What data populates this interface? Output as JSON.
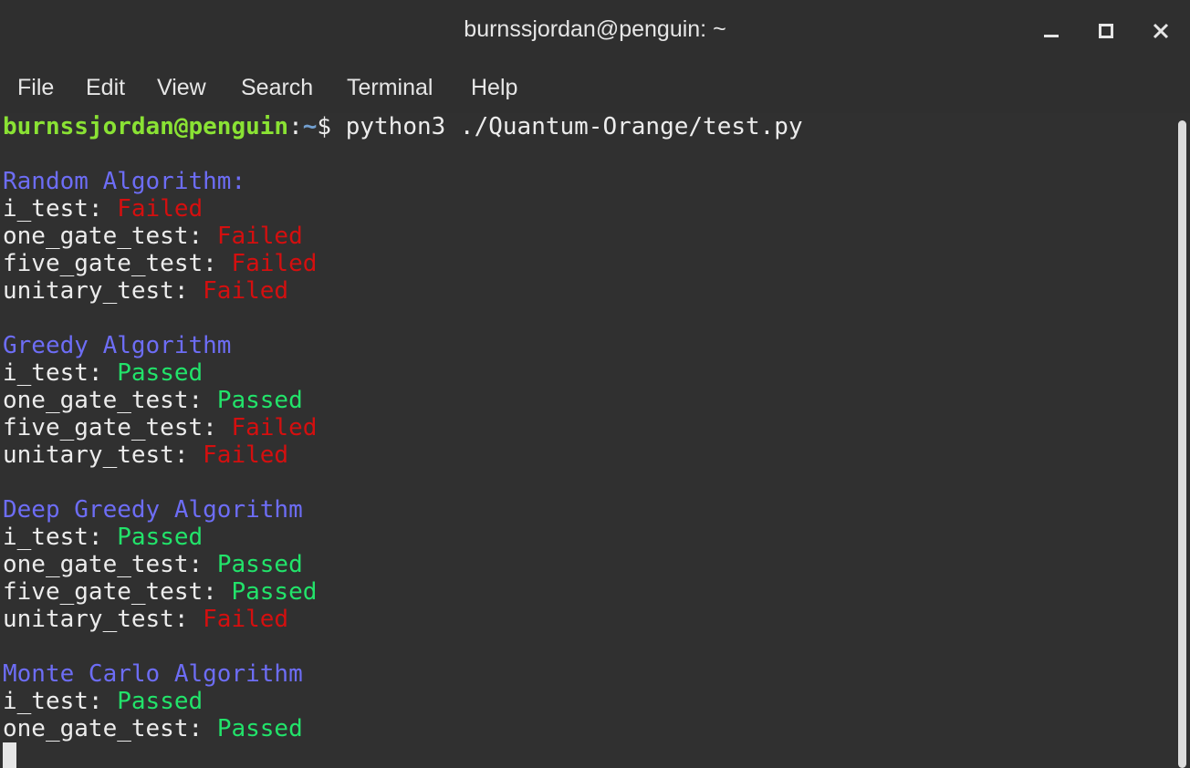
{
  "window": {
    "title": "burnssjordan@penguin: ~",
    "controls": [
      "minimize-icon",
      "maximize-icon",
      "close-icon"
    ]
  },
  "menu": {
    "items": [
      "File",
      "Edit",
      "View",
      "Search",
      "Terminal",
      "Help"
    ]
  },
  "terminal": {
    "prompt_user": "burnssjordan@penguin",
    "prompt_sep": ":",
    "prompt_path": "~",
    "prompt_symbol": "$ ",
    "command": "python3 ./Quantum-Orange/test.py",
    "sections": [
      {
        "header": "Random Algorithm:",
        "tests": [
          {
            "name": "i_test: ",
            "result": "Failed"
          },
          {
            "name": "one_gate_test: ",
            "result": "Failed"
          },
          {
            "name": "five_gate_test: ",
            "result": "Failed"
          },
          {
            "name": "unitary_test: ",
            "result": "Failed"
          }
        ]
      },
      {
        "header": "Greedy Algorithm",
        "tests": [
          {
            "name": "i_test: ",
            "result": "Passed"
          },
          {
            "name": "one_gate_test: ",
            "result": "Passed"
          },
          {
            "name": "five_gate_test: ",
            "result": "Failed"
          },
          {
            "name": "unitary_test: ",
            "result": "Failed"
          }
        ]
      },
      {
        "header": "Deep Greedy Algorithm",
        "tests": [
          {
            "name": "i_test: ",
            "result": "Passed"
          },
          {
            "name": "one_gate_test: ",
            "result": "Passed"
          },
          {
            "name": "five_gate_test: ",
            "result": "Passed"
          },
          {
            "name": "unitary_test: ",
            "result": "Failed"
          }
        ]
      },
      {
        "header": "Monte Carlo Algorithm",
        "tests": [
          {
            "name": "i_test: ",
            "result": "Passed"
          },
          {
            "name": "one_gate_test: ",
            "result": "Passed"
          }
        ]
      }
    ]
  },
  "colors": {
    "background": "#303030",
    "text": "#ececec",
    "prompt_user": "#8ae234",
    "prompt_path": "#729fcf",
    "header": "#6d6df5",
    "passed": "#22e36a",
    "failed": "#d40f0f"
  }
}
